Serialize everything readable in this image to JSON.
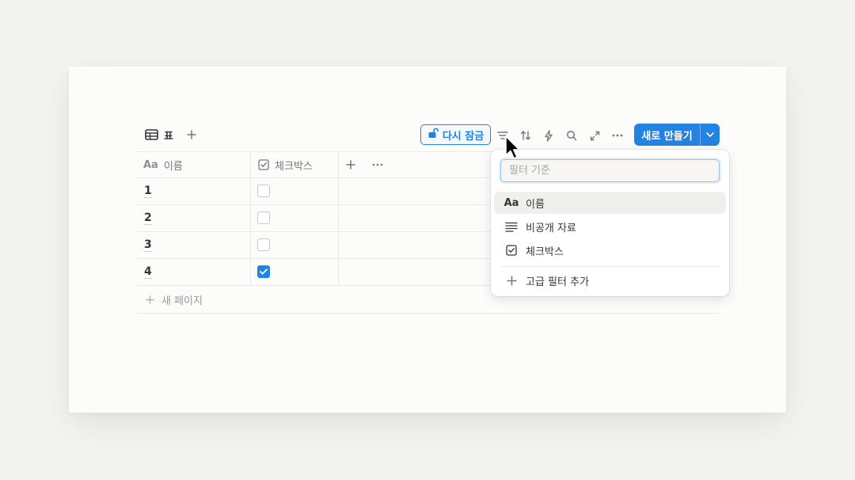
{
  "toolbar": {
    "view_tab_label": "표",
    "relock_label": "다시 잠금",
    "new_button_label": "새로 만들기"
  },
  "table": {
    "columns": [
      {
        "icon": "Aa",
        "label": "이름"
      },
      {
        "icon": "checkbox-icon",
        "label": "체크박스"
      }
    ],
    "rows": [
      {
        "name": "1",
        "checked": false
      },
      {
        "name": "2",
        "checked": false
      },
      {
        "name": "3",
        "checked": false
      },
      {
        "name": "4",
        "checked": true
      }
    ],
    "new_page_label": "새 페이지"
  },
  "filter_menu": {
    "search_placeholder": "필터 기준",
    "items": [
      {
        "icon": "Aa",
        "label": "이름"
      },
      {
        "icon": "text-lines-icon",
        "label": "비공개 자료"
      },
      {
        "icon": "checkbox-icon",
        "label": "체크박스"
      }
    ],
    "advanced_label": "고급 필터 추가"
  },
  "colors": {
    "accent": "#2383e2",
    "page_bg": "#f3f3f1",
    "card_bg": "#fcfcfb"
  }
}
